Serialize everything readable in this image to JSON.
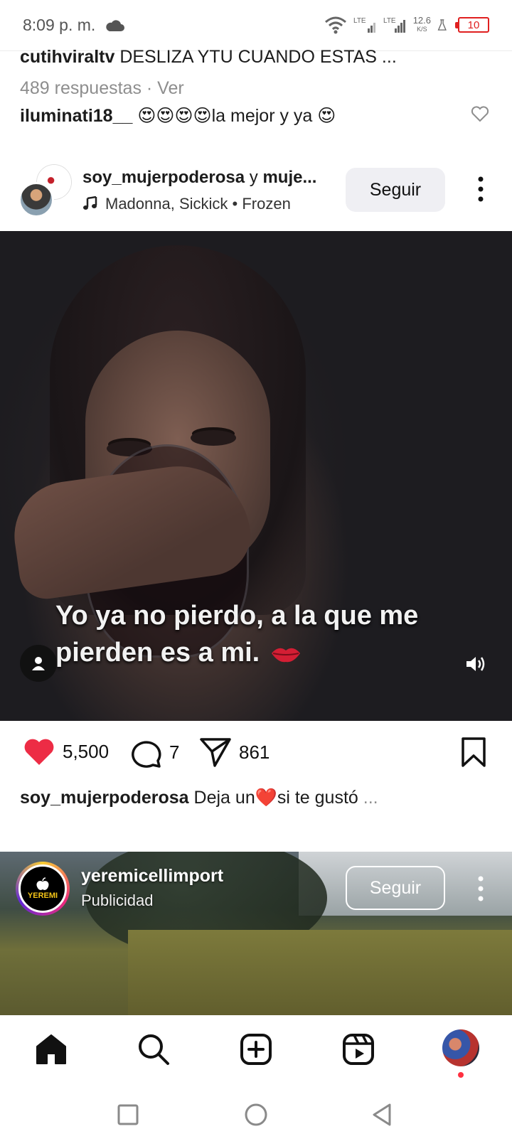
{
  "status_bar": {
    "time": "8:09 p. m.",
    "net_speed_value": "12.6",
    "net_speed_unit": "K/S",
    "battery": "10",
    "signal_labels": [
      "LTE",
      "LTE"
    ]
  },
  "comments_preview": {
    "top_user": "cutihviraltv",
    "top_caption": "DESLIZA YTU CUANDO ESTAS ...",
    "replies_text": "489 respuestas · Ver",
    "reply_user": "iluminati18__",
    "reply_text": "😍😍😍😍la mejor y ya 😍"
  },
  "post": {
    "user_primary": "soy_mujerpoderosa",
    "user_connector": " y ",
    "user_secondary": "muje...",
    "music": "Madonna, Sickick • Frozen",
    "follow_label": "Seguir",
    "overlay_text": "Yo ya no pierdo, a la que me pierden es a mi.",
    "likes": "5,500",
    "comments": "7",
    "shares": "861",
    "caption_user": "soy_mujerpoderosa",
    "caption_text": "Deja un❤️si te gustó",
    "caption_more": " ..."
  },
  "ad": {
    "user": "yeremicellimport",
    "sponsored_label": "Publicidad",
    "follow_label": "Seguir",
    "avatar_brand": "YEREMI"
  },
  "icons": {
    "like": "heart-filled-icon",
    "comment": "comment-bubble-icon",
    "share": "paper-plane-icon",
    "save": "bookmark-icon"
  },
  "colors": {
    "like_red": "#ed2c45",
    "follow_bg": "#efeff3",
    "muted_text": "#8e8e8e",
    "battery_red": "#e02020"
  }
}
